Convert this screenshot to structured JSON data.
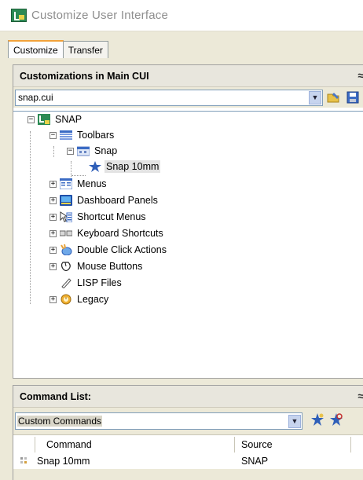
{
  "window": {
    "title": "Customize User Interface"
  },
  "tabs": [
    {
      "label": "Customize"
    },
    {
      "label": "Transfer"
    }
  ],
  "customizations": {
    "header": "Customizations in Main CUI",
    "file_selector_value": "snap.cui",
    "tree": {
      "root": "SNAP",
      "toolbars": "Toolbars",
      "toolbar_snap": "Snap",
      "command_snap10": "Snap 10mm",
      "menus": "Menus",
      "dashboard": "Dashboard Panels",
      "shortcut_menus": "Shortcut Menus",
      "keyboard": "Keyboard Shortcuts",
      "double_click": "Double Click Actions",
      "mouse": "Mouse Buttons",
      "lisp": "LISP Files",
      "legacy": "Legacy"
    }
  },
  "command_list": {
    "header": "Command List:",
    "filter_value": "Custom Commands",
    "columns": {
      "command": "Command",
      "source": "Source"
    },
    "rows": [
      {
        "command": "Snap 10mm",
        "source": "SNAP"
      }
    ]
  },
  "colors": {
    "accent_tab": "#f2a23b",
    "panel_header": "#e8e6dd",
    "window_bg": "#ece9d8"
  }
}
